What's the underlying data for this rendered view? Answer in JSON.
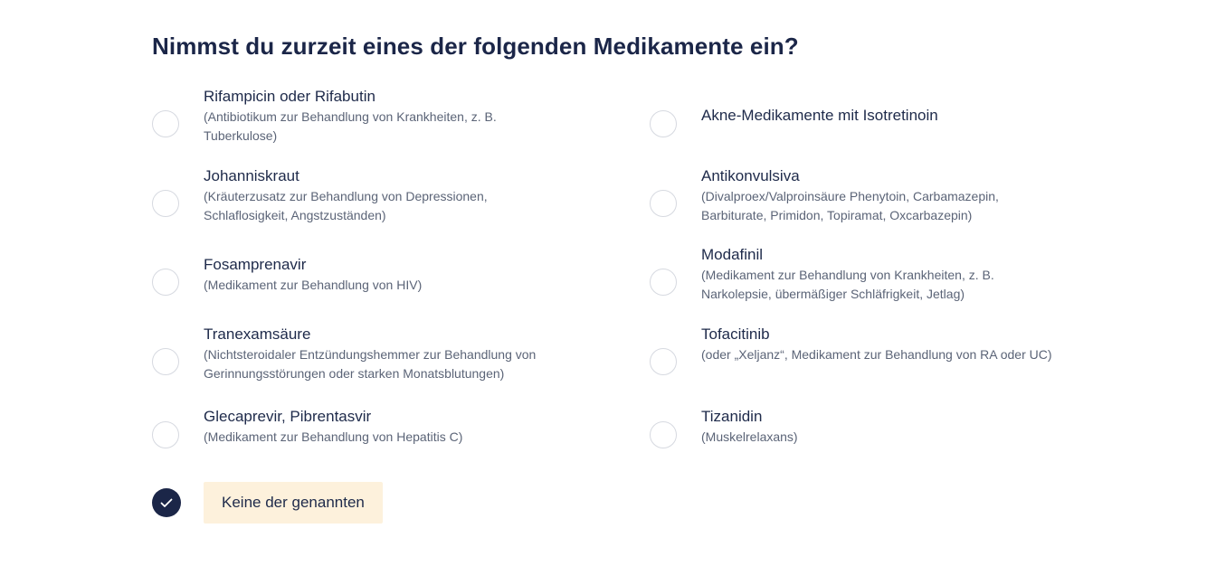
{
  "question": {
    "title": "Nimmst du zurzeit eines der folgenden Medikamente ein?"
  },
  "options_left": [
    {
      "label": "Rifampicin oder Rifabutin",
      "description": "(Antibiotikum zur Behandlung von Krankheiten, z. B. Tuberkulose)",
      "selected": false
    },
    {
      "label": "Johanniskraut",
      "description": "(Kräuterzusatz zur Behandlung von Depressionen, Schlaflosigkeit, Angstzuständen)",
      "selected": false
    },
    {
      "label": "Fosamprenavir",
      "description": "(Medikament zur Behandlung von HIV)",
      "selected": false
    },
    {
      "label": "Tranexamsäure",
      "description": "(Nichtsteroidaler Entzündungshemmer zur Behandlung von Gerinnungsstörungen oder starken Monatsblutungen)",
      "selected": false
    },
    {
      "label": "Glecaprevir, Pibrentasvir",
      "description": "(Medikament zur Behandlung von Hepatitis C)",
      "selected": false
    }
  ],
  "options_right": [
    {
      "label": "Akne-Medikamente mit Isotretinoin",
      "description": "",
      "selected": false
    },
    {
      "label": "Antikonvulsiva",
      "description": "(Divalproex/Valproinsäure Phenytoin, Carbamazepin, Barbiturate, Primidon, Topiramat, Oxcarbazepin)",
      "selected": false
    },
    {
      "label": "Modafinil",
      "description": "(Medikament zur Behandlung von Krankheiten, z. B. Narkolepsie, übermäßiger Schläfrigkeit, Jetlag)",
      "selected": false
    },
    {
      "label": "Tofacitinib",
      "description": "(oder „Xeljanz“, Medikament zur Behandlung von RA oder UC)",
      "selected": false
    },
    {
      "label": "Tizanidin",
      "description": "(Muskelrelaxans)",
      "selected": false
    }
  ],
  "none_option": {
    "label": "Keine der genannten",
    "selected": true,
    "icon": "checkmark-icon"
  },
  "colors": {
    "primary": "#1b2648",
    "selected_highlight": "#fdf1dc",
    "radio_border": "#d6d9e0",
    "description_text": "#5b6477"
  }
}
